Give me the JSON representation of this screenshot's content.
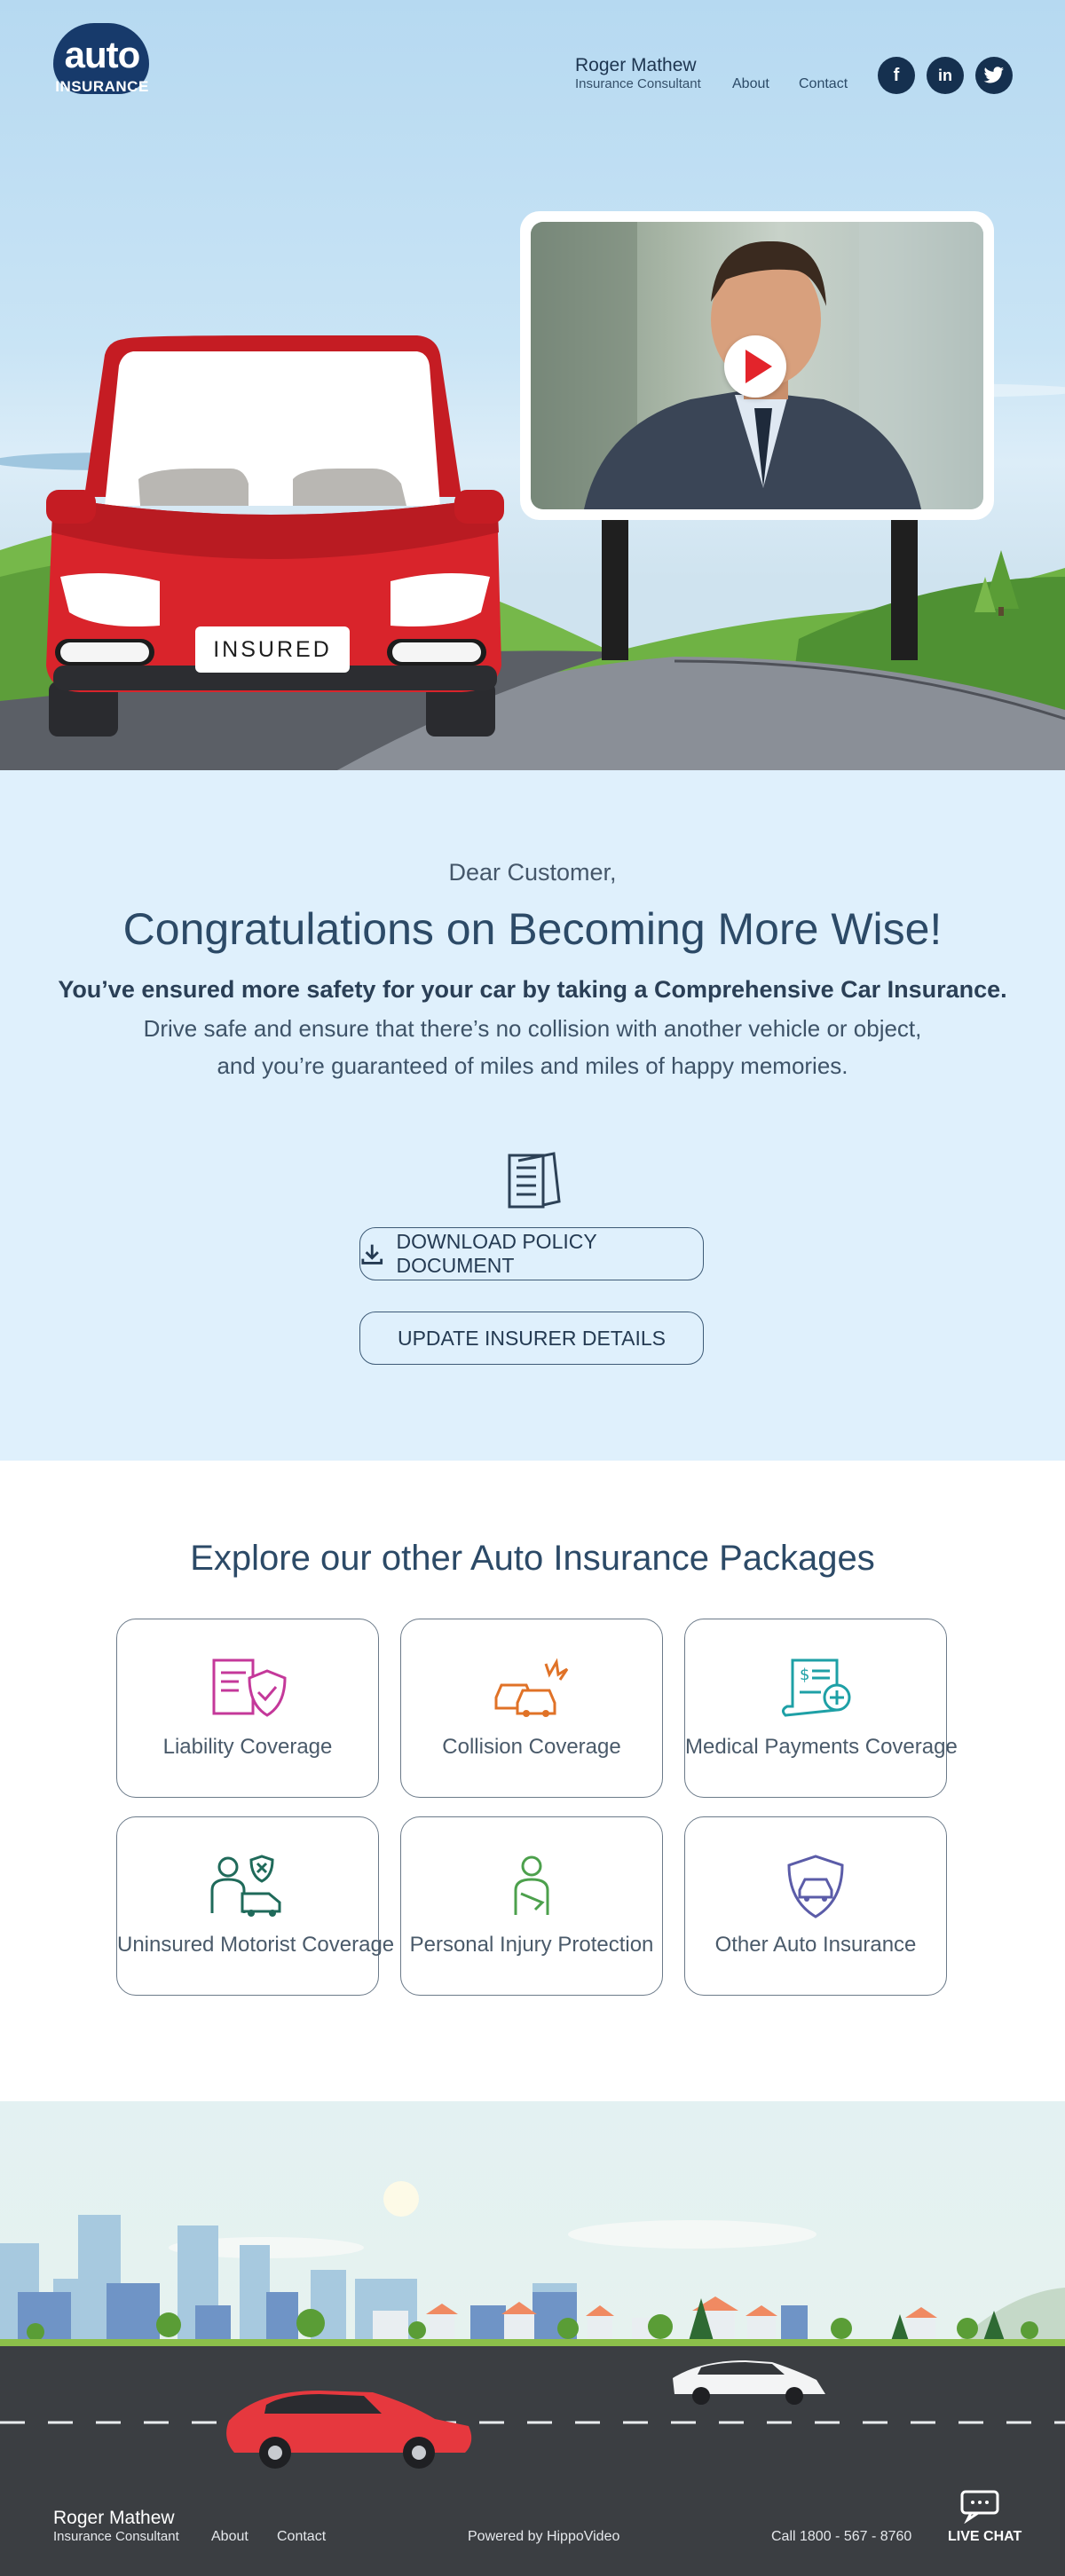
{
  "header": {
    "logo_word": "auto",
    "logo_sub": "INSURANCE",
    "consultant_name": "Roger Mathew",
    "consultant_role": "Insurance Consultant",
    "nav": [
      "About",
      "Contact"
    ],
    "social": [
      "f",
      "in",
      "t"
    ]
  },
  "hero": {
    "plate_text": "INSURED",
    "video_play_icon": "play-icon"
  },
  "message": {
    "greeting": "Dear Customer,",
    "headline": "Congratulations on Becoming More Wise!",
    "bold_line": "You’ve ensured more safety for your car by taking a Comprehensive Car Insurance.",
    "line2": "Drive safe and ensure that there’s no collision with another vehicle or object,",
    "line3": "and you’re guaranteed of miles and miles of happy memories.",
    "download_button": "DOWNLOAD POLICY DOCUMENT",
    "update_button": "UPDATE INSURER DETAILS"
  },
  "packages": {
    "title": "Explore our other Auto Insurance Packages",
    "items": [
      {
        "label": "Liability Coverage",
        "icon": "liability-icon",
        "color": "#c4389a"
      },
      {
        "label": "Collision Coverage",
        "icon": "collision-icon",
        "color": "#e07227"
      },
      {
        "label": "Medical Payments Coverage",
        "icon": "medical-payments-icon",
        "color": "#1ea0a6"
      },
      {
        "label": "Uninsured Motorist Coverage",
        "icon": "uninsured-motorist-icon",
        "color": "#1f6a5a"
      },
      {
        "label": "Personal Injury Protection",
        "icon": "personal-injury-icon",
        "color": "#4ca04c"
      },
      {
        "label": "Other Auto Insurance",
        "icon": "other-insurance-icon",
        "color": "#5b5ca8"
      }
    ]
  },
  "footer": {
    "name": "Roger Mathew",
    "role": "Insurance Consultant",
    "nav": [
      "About",
      "Contact"
    ],
    "powered": "Powered by HippoVideo",
    "phone": "Call 1800 - 567 - 8760",
    "live_chat": "LIVE CHAT"
  }
}
